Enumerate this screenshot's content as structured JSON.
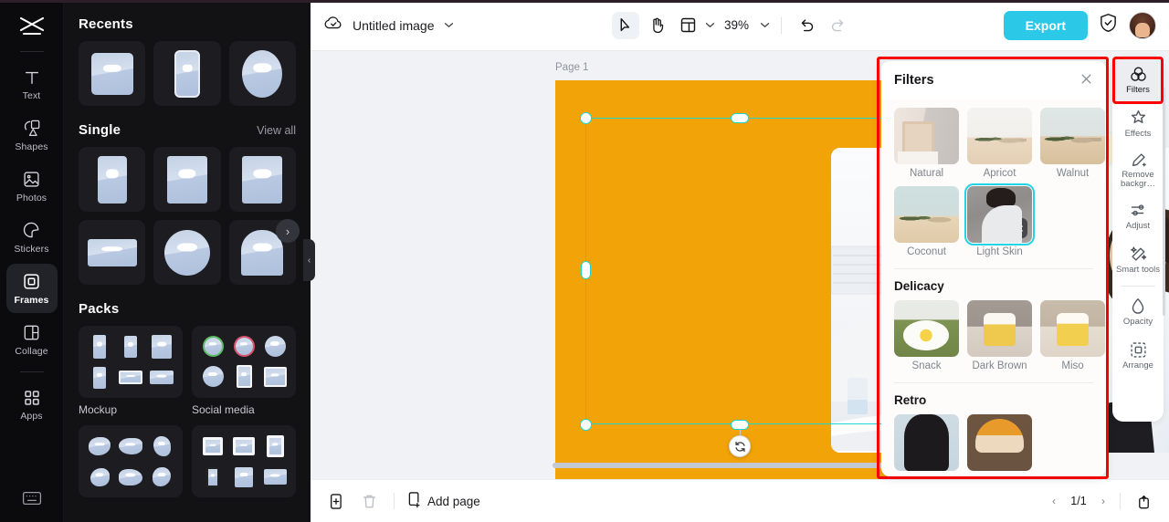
{
  "left_rail": {
    "logo_name": "app-logo",
    "items": [
      {
        "label": "Text",
        "icon": "text-icon"
      },
      {
        "label": "Shapes",
        "icon": "shapes-icon"
      },
      {
        "label": "Photos",
        "icon": "photos-icon"
      },
      {
        "label": "Stickers",
        "icon": "stickers-icon"
      },
      {
        "label": "Frames",
        "icon": "frames-icon",
        "active": true
      },
      {
        "label": "Collage",
        "icon": "collage-icon"
      },
      {
        "label": "Apps",
        "icon": "apps-icon"
      }
    ],
    "bottom_icon": "keyboard-icon"
  },
  "panel": {
    "recents": {
      "title": "Recents",
      "items": [
        "square-frame",
        "phone-frame",
        "oval-frame"
      ]
    },
    "single": {
      "title": "Single",
      "view_all": "View all",
      "items": [
        "tall-frame",
        "portrait-frame",
        "portrait-frame-2",
        "wide-frame",
        "circle-frame",
        "arch-frame"
      ]
    },
    "packs": {
      "title": "Packs",
      "items": [
        {
          "label": "Mockup"
        },
        {
          "label": "Social media"
        },
        {
          "label": ""
        },
        {
          "label": ""
        }
      ]
    },
    "next_arrow": "›",
    "collapse_arrow": "‹"
  },
  "topbar": {
    "cloud_icon": "cloud-sync-icon",
    "doc_title": "Untitled image",
    "title_chevron": "⌄",
    "tools": [
      {
        "name": "select-tool",
        "icon": "cursor-icon",
        "selected": true
      },
      {
        "name": "hand-tool",
        "icon": "hand-icon",
        "selected": false
      },
      {
        "name": "layout-tool",
        "icon": "layout-icon",
        "selected": false
      }
    ],
    "layout_chevron": "⌄",
    "zoom": "39%",
    "zoom_chevron": "⌄",
    "undo_icon": "undo-arrow-icon",
    "redo_icon": "redo-arrow-icon",
    "export_label": "Export",
    "shield_icon": "shield-check-icon",
    "avatar": "user-avatar"
  },
  "canvas": {
    "page_label": "Page 1",
    "artboard_color": "#f2a307",
    "selection_color": "#1fd6d0",
    "floating_toolbar": [
      {
        "name": "crop-button",
        "icon": "crop-icon"
      },
      {
        "name": "replace-button",
        "icon": "replace-icon"
      },
      {
        "name": "duplicate-button",
        "icon": "duplicate-icon"
      },
      {
        "name": "more-button",
        "icon": "ellipsis-icon"
      }
    ],
    "rotate_icon": "rotate-icon",
    "image_alt": "two women talking on sofa"
  },
  "filters_panel": {
    "title": "Filters",
    "close_icon": "close-icon",
    "highlight_color": "#ff0000",
    "sections": [
      {
        "title": "",
        "items": [
          {
            "name": "Natural",
            "thumb": "t-natural",
            "active": false
          },
          {
            "name": "Apricot",
            "thumb": "t-desert",
            "active": false
          },
          {
            "name": "Walnut",
            "thumb": "t-walnut",
            "active": false
          },
          {
            "name": "Coconut",
            "thumb": "t-coconut",
            "active": false
          },
          {
            "name": "Light Skin",
            "thumb": "t-skin",
            "active": true
          }
        ]
      },
      {
        "title": "Delicacy",
        "items": [
          {
            "name": "Snack",
            "thumb": "t-snack",
            "active": false
          },
          {
            "name": "Dark Brown",
            "thumb": "t-darkbrown",
            "active": false
          },
          {
            "name": "Miso",
            "thumb": "t-miso",
            "active": false
          }
        ]
      },
      {
        "title": "Retro",
        "items": [
          {
            "name": "",
            "thumb": "t-retro1",
            "active": false
          },
          {
            "name": "",
            "thumb": "t-retro2",
            "active": false
          }
        ]
      }
    ],
    "adjust_badge_icon": "sliders-icon"
  },
  "right_rail": {
    "items": [
      {
        "label": "Filters",
        "icon": "filters-icon",
        "active": true
      },
      {
        "label": "Effects",
        "icon": "effects-icon",
        "active": false
      },
      {
        "label": "Remove backgr…",
        "icon": "remove-background-icon",
        "active": false
      },
      {
        "label": "Adjust",
        "icon": "adjust-icon",
        "active": false
      },
      {
        "label": "Smart tools",
        "icon": "smart-tools-icon",
        "active": false
      },
      {
        "label": "Opacity",
        "icon": "opacity-icon",
        "active": false
      },
      {
        "label": "Arrange",
        "icon": "arrange-icon",
        "active": false
      }
    ]
  },
  "bottombar": {
    "duplicate_page_icon": "duplicate-page-icon",
    "delete_page_icon": "trash-icon",
    "add_page_icon": "add-page-icon",
    "add_page_label": "Add page",
    "prev_arrow": "‹",
    "page_indicator": "1/1",
    "next_arrow": "›",
    "export_page_icon": "export-page-icon"
  }
}
